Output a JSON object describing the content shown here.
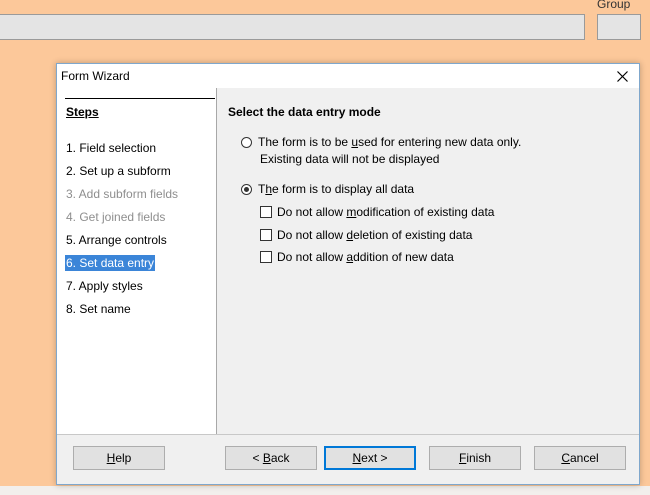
{
  "background": {
    "group_label": "Group"
  },
  "dialog": {
    "title": "Form Wizard",
    "sidebar": {
      "heading": "Steps",
      "steps": [
        {
          "label": "1. Field selection",
          "state": "normal"
        },
        {
          "label": "2. Set up a subform",
          "state": "normal"
        },
        {
          "label": "3. Add subform fields",
          "state": "disabled"
        },
        {
          "label": "4. Get joined fields",
          "state": "disabled"
        },
        {
          "label": "5. Arrange controls",
          "state": "normal"
        },
        {
          "label": "6. Set data entry",
          "state": "active"
        },
        {
          "label": "7. Apply styles",
          "state": "normal"
        },
        {
          "label": "8. Set name",
          "state": "normal"
        }
      ]
    },
    "content": {
      "title": "Select the data entry mode",
      "option_new": {
        "line1_pre": "The form is to be ",
        "line1_mnemonic": "u",
        "line1_post": "sed for entering new data only.",
        "line2": "Existing data will not be displayed",
        "checked": false
      },
      "option_all": {
        "pre": "T",
        "mnemonic": "h",
        "post": "e form is to display all data",
        "checked": true
      },
      "checks": [
        {
          "pre": "Do not allow ",
          "mnemonic": "m",
          "post": "odification of existing data",
          "checked": false
        },
        {
          "pre": "Do not allow ",
          "mnemonic": "d",
          "post": "eletion of existing data",
          "checked": false
        },
        {
          "pre": "Do not allow ",
          "mnemonic": "a",
          "post": "ddition of new data",
          "checked": false
        }
      ]
    },
    "buttons": {
      "help": {
        "mnemonic": "H",
        "rest": "elp"
      },
      "back": {
        "pre": "< ",
        "mnemonic": "B",
        "rest": "ack"
      },
      "next": {
        "mnemonic": "N",
        "rest": "ext >"
      },
      "finish": {
        "mnemonic": "F",
        "rest": "inish"
      },
      "cancel": {
        "mnemonic": "C",
        "rest": "ancel"
      }
    }
  }
}
